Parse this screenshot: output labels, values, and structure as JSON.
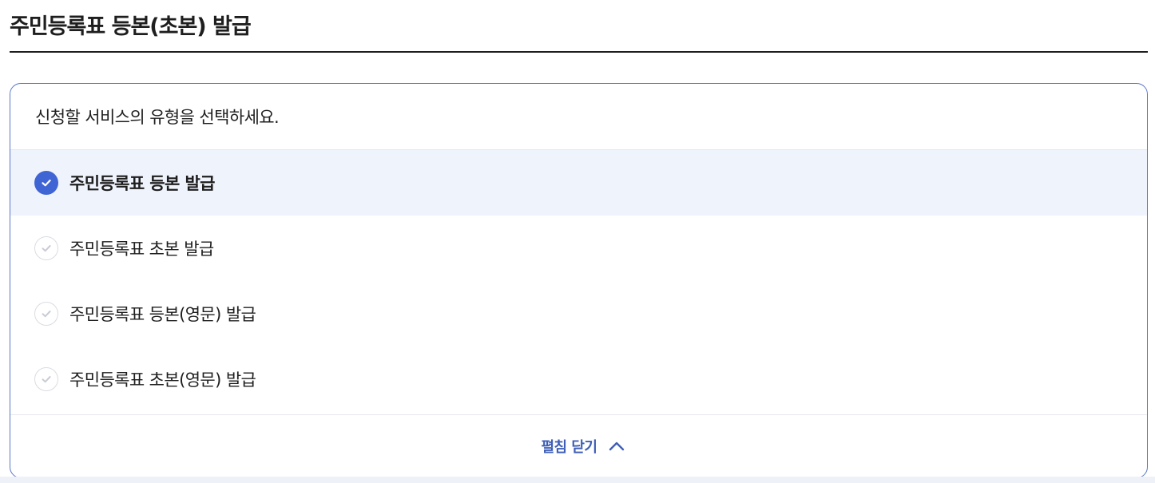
{
  "page": {
    "title": "주민등록표 등본(초본) 발급"
  },
  "service_selector": {
    "prompt": "신청할 서비스의 유형을 선택하세요.",
    "options": [
      {
        "label": "주민등록표 등본 발급",
        "selected": true
      },
      {
        "label": "주민등록표 초본 발급",
        "selected": false
      },
      {
        "label": "주민등록표 등본(영문) 발급",
        "selected": false
      },
      {
        "label": "주민등록표 초본(영문) 발급",
        "selected": false
      }
    ],
    "collapse_label": "펼침 닫기"
  },
  "colors": {
    "accent": "#3f64d4",
    "selected_row_bg": "#eff3fc",
    "card_border": "#5a78c9",
    "footer_text": "#3f5fb7",
    "unchecked_mark": "#c8ccd4"
  },
  "icons": {
    "selected": "check-circle-filled-icon",
    "unselected": "check-circle-outline-icon",
    "collapse": "chevron-up-icon"
  }
}
